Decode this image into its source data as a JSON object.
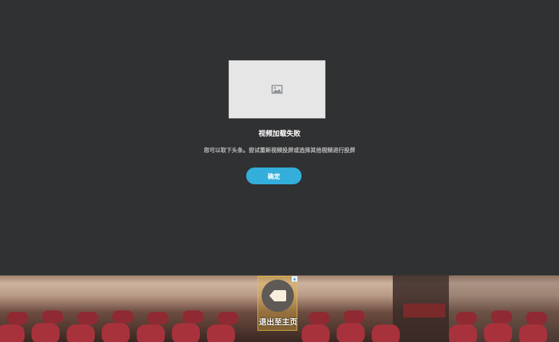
{
  "dialog": {
    "thumbnail_icon": "image-placeholder-icon",
    "title": "视频加载失败",
    "message": "您可以取下头条。尝试重新视频投屏或选择其他视频进行投屏",
    "confirm_label": "确定"
  },
  "overlay": {
    "exit_icon": "tag-shape-icon",
    "exit_label": "退出至主页",
    "badge_icon": "lightning-icon"
  },
  "colors": {
    "background": "#303133",
    "accent": "#34aedb",
    "seat": "#a8323c"
  }
}
